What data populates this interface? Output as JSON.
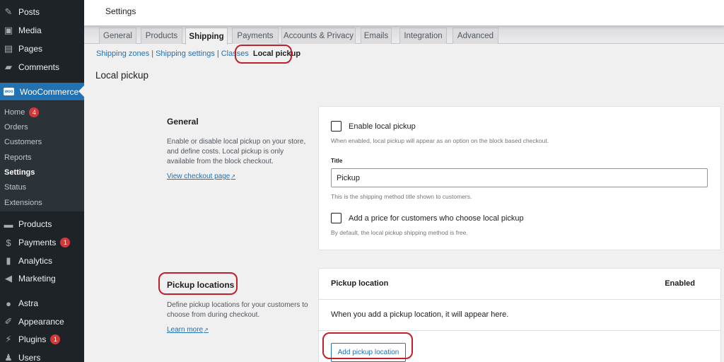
{
  "sidebar": {
    "items": [
      {
        "label": "Posts",
        "icon": "pin-icon"
      },
      {
        "label": "Media",
        "icon": "media-icon"
      },
      {
        "label": "Pages",
        "icon": "pages-icon"
      },
      {
        "label": "Comments",
        "icon": "comment-icon"
      },
      {
        "label": "WooCommerce",
        "icon": "woo-icon",
        "active": true
      }
    ],
    "woo_logo_text": "woo",
    "submenu": [
      {
        "label": "Home",
        "badge": "4"
      },
      {
        "label": "Orders"
      },
      {
        "label": "Customers"
      },
      {
        "label": "Reports"
      },
      {
        "label": "Settings",
        "current": true
      },
      {
        "label": "Status"
      },
      {
        "label": "Extensions"
      }
    ],
    "items_after": [
      {
        "label": "Products",
        "icon": "products-icon"
      },
      {
        "label": "Payments",
        "icon": "payments-icon",
        "badge": "1"
      },
      {
        "label": "Analytics",
        "icon": "analytics-icon"
      },
      {
        "label": "Marketing",
        "icon": "megaphone-icon"
      },
      {
        "label": "Astra",
        "icon": "astra-icon"
      },
      {
        "label": "Appearance",
        "icon": "brush-icon"
      },
      {
        "label": "Plugins",
        "icon": "plugin-icon",
        "badge": "1"
      },
      {
        "label": "Users",
        "icon": "user-icon"
      }
    ]
  },
  "header": {
    "title": "Settings"
  },
  "tabs": [
    {
      "label": "General"
    },
    {
      "label": "Products"
    },
    {
      "label": "Shipping",
      "active": true
    },
    {
      "label": "Payments"
    },
    {
      "label": "Accounts & Privacy"
    },
    {
      "label": "Emails"
    },
    {
      "label": "Integration"
    },
    {
      "label": "Advanced"
    }
  ],
  "subnav": {
    "links": [
      "Shipping zones",
      "Shipping settings",
      "Classes"
    ],
    "separator": "|",
    "current": "Local pickup"
  },
  "page_heading": "Local pickup",
  "general": {
    "title": "General",
    "description": "Enable or disable local pickup on your store, and define costs. Local pickup is only available from the block checkout.",
    "link": "View checkout page",
    "enable_label": "Enable local pickup",
    "enable_checked": false,
    "enable_help": "When enabled, local pickup will appear as an option on the block based checkout.",
    "title_label": "Title",
    "title_value": "Pickup",
    "title_help": "This is the shipping method title shown to customers.",
    "price_label": "Add a price for customers who choose local pickup",
    "price_checked": false,
    "price_help": "By default, the local pickup shipping method is free."
  },
  "pickup": {
    "title": "Pickup locations",
    "description": "Define pickup locations for your customers to choose from during checkout.",
    "link": "Learn more",
    "col_location": "Pickup location",
    "col_enabled": "Enabled",
    "empty_text": "When you add a pickup location, it will appear here.",
    "add_button": "Add pickup location"
  },
  "icons": {
    "external": "↗"
  },
  "colors": {
    "accent": "#2271b1",
    "sidebar": "#1d2327",
    "badge": "#d63638",
    "highlight": "#c0202a"
  }
}
